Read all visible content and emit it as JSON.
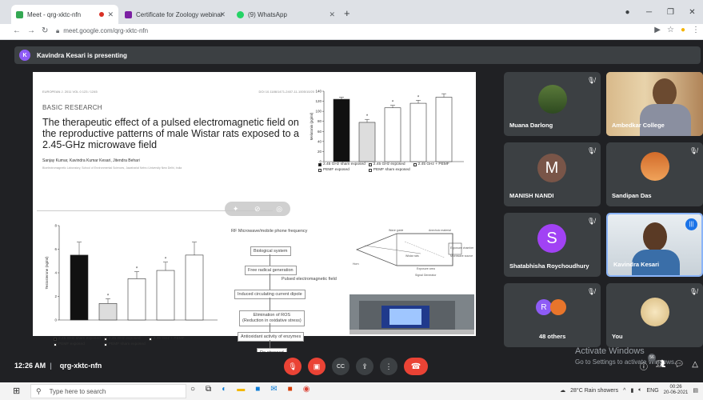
{
  "browser": {
    "tabs": [
      {
        "label": "Meet - qrg-xktc-nfn",
        "active": true
      },
      {
        "label": "Certificate for Zoology webinar",
        "active": false
      },
      {
        "label": "(9) WhatsApp",
        "active": false
      }
    ],
    "url": "meet.google.com/qrg-xktc-nfn"
  },
  "meet": {
    "presenter_initial": "K",
    "presenting_text": "Kavindra Kesari is presenting",
    "time": "12:26 AM",
    "meeting_code": "qrg-xktc-nfn",
    "activate_title": "Activate Windows",
    "activate_sub": "Go to Settings to activate Windows.",
    "people_count": "56"
  },
  "slide": {
    "journal_ref": "EUROPEAN J. 2011 VOL 0 123 / 1245",
    "doi": "DOI 10.1186/1471-2407-11-1005/10/20",
    "section": "BASIC RESEARCH",
    "title": "The therapeutic effect of a pulsed electromagnetic field on the reproductive patterns of male Wistar rats exposed to a 2.45-GHz microwave field",
    "authors": "Sanjay Kumar, Kavindra Kumar Kesari, Jitendra Behari",
    "affiliation": "Bioelectromagnetic Laboratory, School of Environmental Sciences, Jawaharlal Nehru University New Delhi, India",
    "flow": {
      "top": "RF Microwave/mobile phone frequency",
      "step1": "Biological system",
      "step2": "Free radical generation",
      "side": "Pulsed electromagnetic field",
      "step3": "Induced circulating current dipole",
      "step4a": "Elimination of ROS",
      "step4b": "(Reduction in oxidative stress)",
      "step5": "Antioxidant activity of enzymes",
      "step6": "De-stressed"
    },
    "diagram_labels": [
      "Wave guide",
      "Anechoic material",
      "Exposure chamber",
      "Wistar rats",
      "Microwave source",
      "Horn",
      "Exposure area",
      "Signal Generator"
    ]
  },
  "chart_data": [
    {
      "type": "bar",
      "ylabel": "Melatonin (pg/ml)",
      "ylim": [
        0,
        140
      ],
      "yticks": [
        "0",
        "20",
        "40",
        "60",
        "80",
        "100",
        "120",
        "140"
      ],
      "categories": [
        "2.45 GHz sham exposed",
        "2.45 GHz exposed",
        "PEMF sham exposed",
        "2.45 GHz + PEMF",
        "PEMF exposed"
      ],
      "values": [
        124,
        78,
        107,
        116,
        128
      ],
      "errors": [
        4,
        6,
        5,
        6,
        7
      ],
      "significant": [
        false,
        true,
        true,
        true,
        false
      ],
      "legend": [
        "2.45 GHz sham exposed",
        "2.45 GHz exposed",
        "2.45 GHz + PEMF",
        "PEMF exposed",
        "PEMF sham exposed"
      ],
      "fills": [
        "#111111",
        "#dddddd",
        "#ffffff",
        "#ffffff",
        "#ffffff"
      ]
    },
    {
      "type": "bar",
      "ylabel": "Testosterone (ng/ml)",
      "ylim": [
        0,
        8
      ],
      "yticks": [
        "0",
        "2",
        "4",
        "6",
        "8"
      ],
      "categories": [
        "2.45 GHz sham exposed",
        "2.45 GHz exposed",
        "PEMF sham exposed",
        "2.45 GHz + PEMF",
        "PEMF exposed"
      ],
      "values": [
        5.5,
        1.4,
        3.5,
        4.2,
        5.5
      ],
      "errors": [
        1.1,
        0.4,
        0.6,
        0.7,
        1.1
      ],
      "significant": [
        false,
        true,
        true,
        true,
        false
      ],
      "legend": [
        "2.45 GHz sham exposed",
        "2.45 GHz exposed",
        "2.45 GHz + PEMF",
        "PEMF exposed",
        "PEMF sham exposed"
      ],
      "fills": [
        "#111111",
        "#dddddd",
        "#ffffff",
        "#ffffff",
        "#ffffff"
      ]
    }
  ],
  "participants": [
    {
      "name": "Muana Darlong",
      "kind": "photo",
      "muted": true
    },
    {
      "name": "Ambedkar College",
      "kind": "video",
      "muted": false
    },
    {
      "name": "MANISH NANDI",
      "kind": "letter",
      "letter": "M",
      "color": "#795548",
      "muted": true
    },
    {
      "name": "Sandipan Das",
      "kind": "photo",
      "muted": true
    },
    {
      "name": "Shatabhisha Roychoudhury",
      "kind": "letter",
      "letter": "S",
      "color": "#a142f4",
      "muted": true
    },
    {
      "name": "Kavindra Kesari",
      "kind": "video",
      "muted": false,
      "speaking": true
    },
    {
      "name": "48 others",
      "kind": "others",
      "letter": "R",
      "muted": true
    },
    {
      "name": "You",
      "kind": "you",
      "muted": true
    }
  ],
  "taskbar": {
    "search_placeholder": "Type here to search",
    "weather": "28°C  Rain showers",
    "lang": "ENG",
    "clock_time": "00:26",
    "clock_date": "20-06-2021"
  }
}
